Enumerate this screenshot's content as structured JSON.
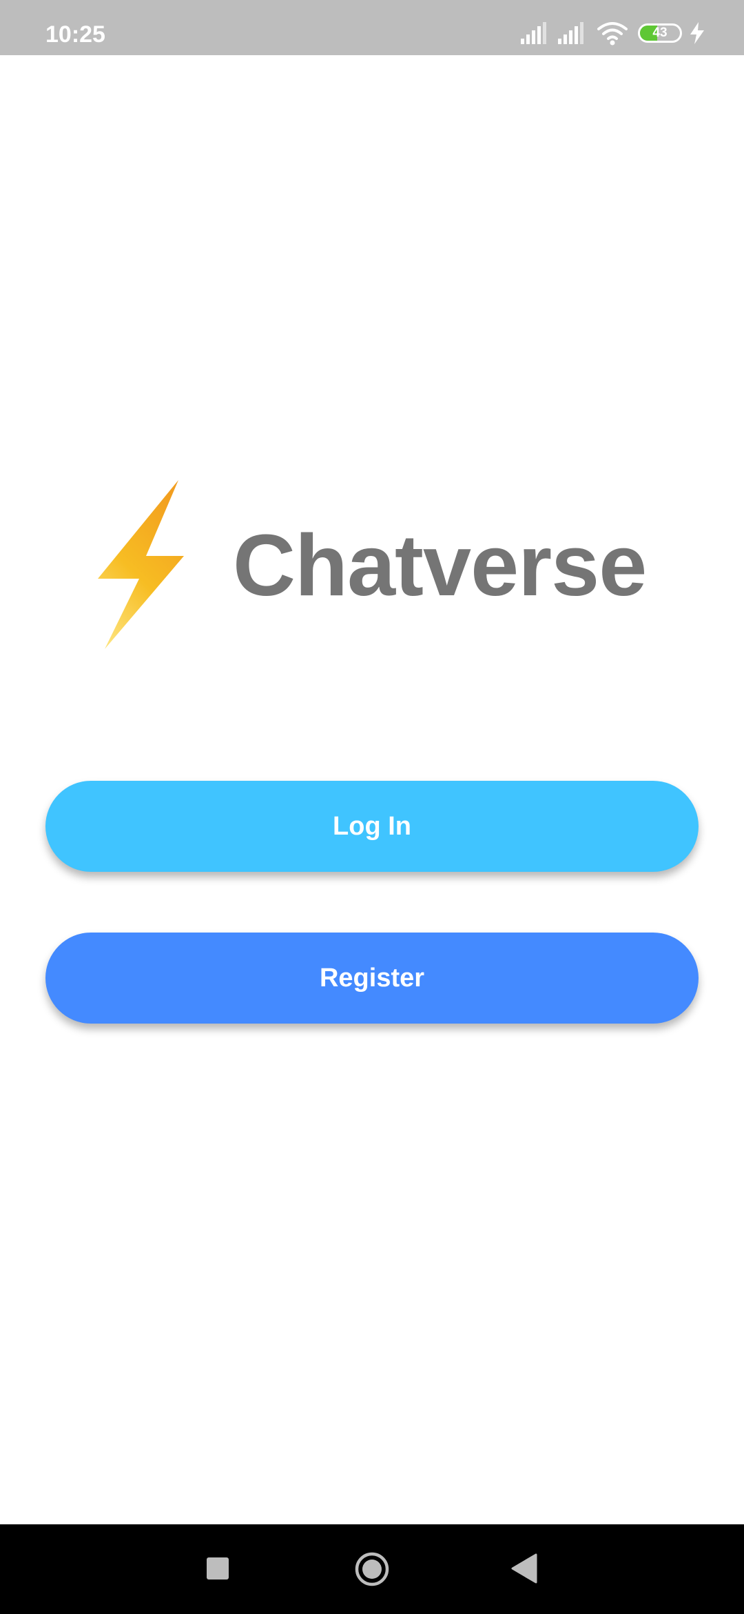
{
  "status_bar": {
    "time": "10:25",
    "battery_level": "43",
    "battery_fraction": 0.43,
    "icons": [
      "signal-icon",
      "signal-icon",
      "wifi-icon",
      "battery-icon",
      "charging-icon"
    ]
  },
  "app": {
    "name": "Chatverse",
    "logo_icon": "lightning-bolt-icon"
  },
  "buttons": {
    "login_label": "Log In",
    "register_label": "Register"
  },
  "nav_bar": {
    "icons": [
      "recents-square-icon",
      "home-circle-icon",
      "back-triangle-icon"
    ]
  },
  "colors": {
    "status_bar": "#bdbdbd",
    "login_button": "#40c4ff",
    "register_button": "#448aff",
    "app_name": "#757575",
    "bolt_gradient_top": "#f5a623",
    "bolt_gradient_bottom": "#fcd54a",
    "battery_fill": "#5ec734"
  }
}
